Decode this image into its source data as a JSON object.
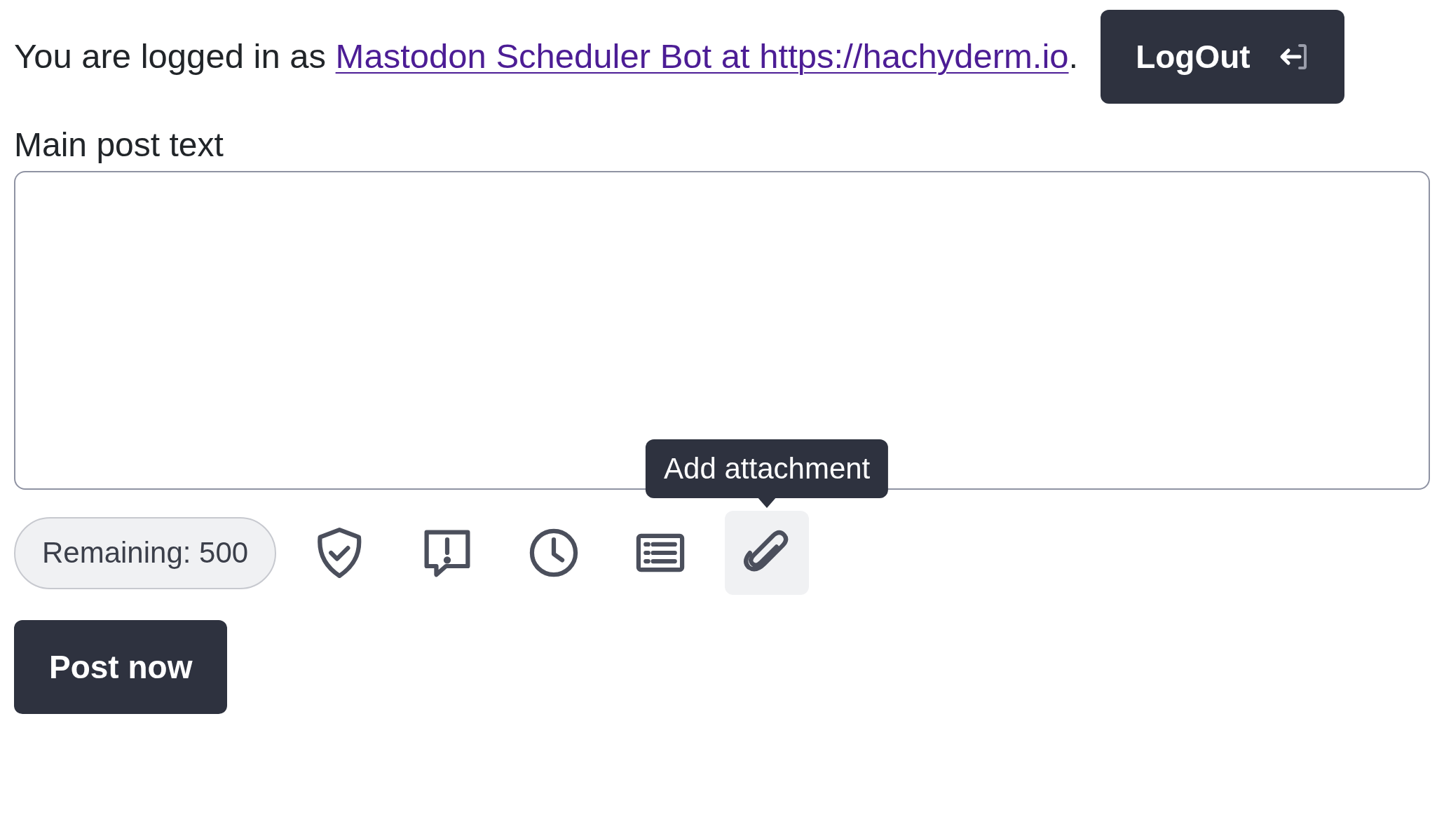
{
  "login": {
    "prefix": "You are logged in as",
    "link": "Mastodon Scheduler Bot at https://hachyderm.io",
    "suffix": "."
  },
  "logout_button": {
    "label": "LogOut"
  },
  "post_text": {
    "label": "Main post text"
  },
  "remaining": "Remaining: 500",
  "tools": [
    {
      "kind": "shield",
      "hovered": false
    },
    {
      "kind": "warning",
      "hovered": false
    },
    {
      "kind": "clock",
      "hovered": false
    },
    {
      "kind": "list",
      "hovered": false
    },
    {
      "kind": "attachment",
      "hovered": true,
      "tooltip": "Add attachment"
    }
  ],
  "post_button": {
    "label": "Post now"
  }
}
